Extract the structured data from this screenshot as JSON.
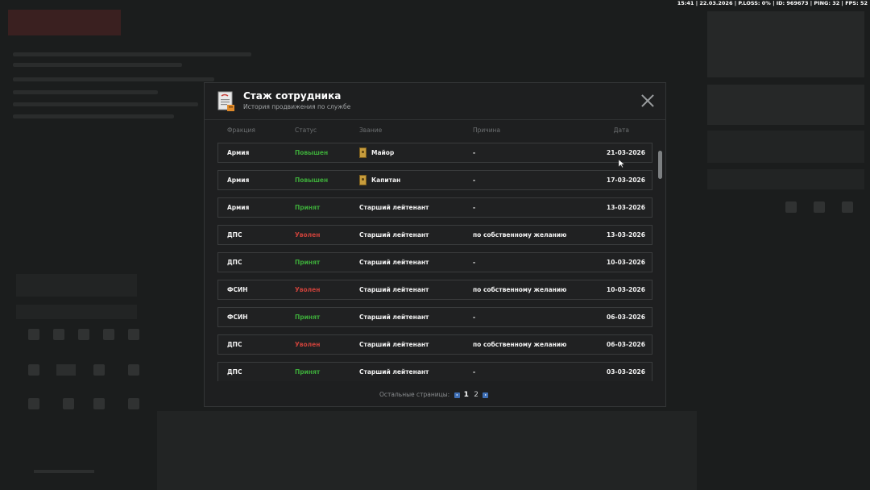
{
  "status_bar": "15:41 | 22.03.2026 | P.LOSS: 0% | ID: 969673 | PING: 32 | FPS: 52",
  "modal": {
    "title": "Стаж сотрудника",
    "subtitle": "История продвижения по службе",
    "close_icon": "close-icon"
  },
  "columns": {
    "faction": "Фракция",
    "status": "Статус",
    "rank": "Звание",
    "reason": "Причина",
    "date": "Дата"
  },
  "rows": [
    {
      "faction": "Армия",
      "status": "Повышен",
      "status_type": "promoted",
      "rank": "Майор",
      "rank_icon": true,
      "reason": "-",
      "date": "21-03-2026"
    },
    {
      "faction": "Армия",
      "status": "Повышен",
      "status_type": "promoted",
      "rank": "Капитан",
      "rank_icon": true,
      "reason": "-",
      "date": "17-03-2026"
    },
    {
      "faction": "Армия",
      "status": "Принят",
      "status_type": "accepted",
      "rank": "Старший лейтенант",
      "rank_icon": false,
      "reason": "-",
      "date": "13-03-2026"
    },
    {
      "faction": "ДПС",
      "status": "Уволен",
      "status_type": "fired",
      "rank": "Старший лейтенант",
      "rank_icon": false,
      "reason": "по собственному желанию",
      "date": "13-03-2026"
    },
    {
      "faction": "ДПС",
      "status": "Принят",
      "status_type": "accepted",
      "rank": "Старший лейтенант",
      "rank_icon": false,
      "reason": "-",
      "date": "10-03-2026"
    },
    {
      "faction": "ФСИН",
      "status": "Уволен",
      "status_type": "fired",
      "rank": "Старший лейтенант",
      "rank_icon": false,
      "reason": "по собственному желанию",
      "date": "10-03-2026"
    },
    {
      "faction": "ФСИН",
      "status": "Принят",
      "status_type": "accepted",
      "rank": "Старший лейтенант",
      "rank_icon": false,
      "reason": "-",
      "date": "06-03-2026"
    },
    {
      "faction": "ДПС",
      "status": "Уволен",
      "status_type": "fired",
      "rank": "Старший лейтенант",
      "rank_icon": false,
      "reason": "по собственному желанию",
      "date": "06-03-2026"
    },
    {
      "faction": "ДПС",
      "status": "Принят",
      "status_type": "accepted",
      "rank": "Старший лейтенант",
      "rank_icon": false,
      "reason": "-",
      "date": "03-03-2026"
    }
  ],
  "pager": {
    "label": "Остальные страницы:",
    "pages": [
      "1",
      "2"
    ],
    "current": "1"
  },
  "colors": {
    "promoted": "#3daa3a",
    "fired": "#c8413a",
    "accent": "#3f6fb5"
  }
}
